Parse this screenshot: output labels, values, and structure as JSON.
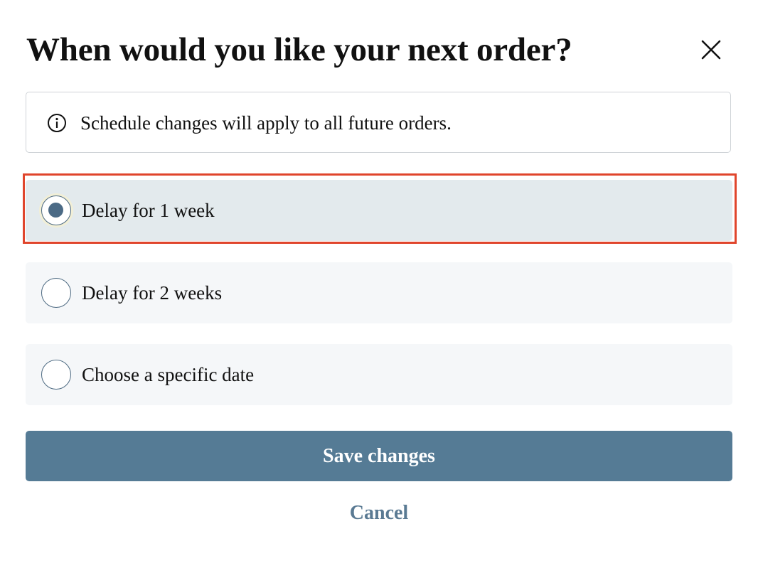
{
  "dialog": {
    "title": "When would you like your next order?",
    "close_icon": "close-icon"
  },
  "info": {
    "icon": "info-icon",
    "text": "Schedule changes will apply to all future orders."
  },
  "options": [
    {
      "label": "Delay for 1 week",
      "selected": true
    },
    {
      "label": "Delay for 2 weeks",
      "selected": false
    },
    {
      "label": "Choose a specific date",
      "selected": false
    }
  ],
  "actions": {
    "save_label": "Save changes",
    "cancel_label": "Cancel"
  },
  "colors": {
    "accent": "#557b95",
    "radio_fill": "#4b6a85",
    "selected_bg": "#e3eaed",
    "option_bg": "#f5f7f9",
    "highlight": "#e0452c"
  }
}
